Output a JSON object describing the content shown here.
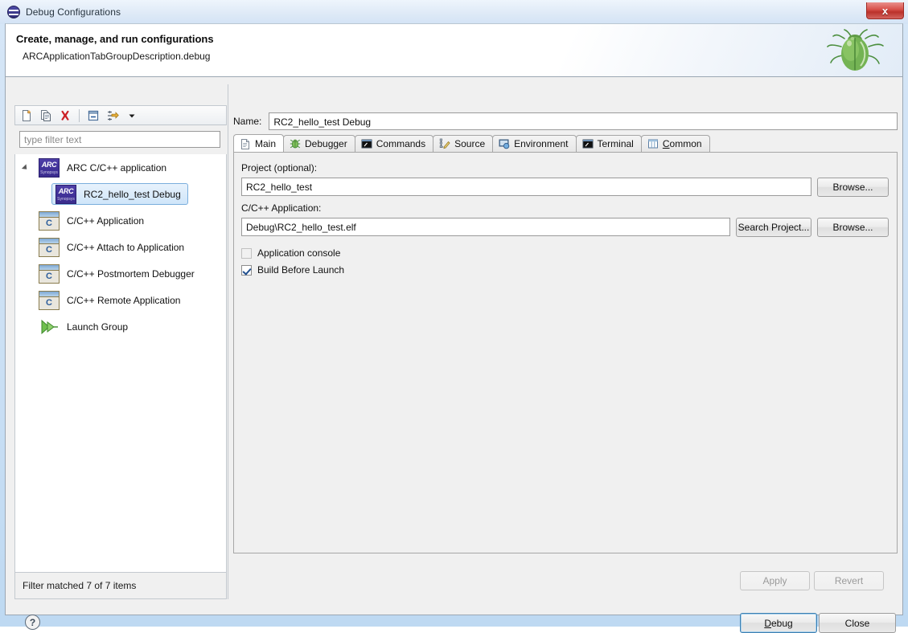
{
  "window": {
    "title": "Debug Configurations",
    "title_icon": "debug-icon",
    "close_label": "x"
  },
  "header": {
    "title": "Create, manage, and run configurations",
    "subtitle": "ARCApplicationTabGroupDescription.debug",
    "decoration_icon": "green-bug-icon"
  },
  "left_panel": {
    "toolbar": [
      {
        "name": "new-configuration-icon",
        "tooltip": "New launch configuration"
      },
      {
        "name": "duplicate-configuration-icon",
        "tooltip": "Duplicate"
      },
      {
        "name": "delete-configuration-icon",
        "tooltip": "Delete"
      },
      {
        "name": "collapse-all-icon",
        "tooltip": "Collapse All"
      },
      {
        "name": "filter-configurations-icon",
        "tooltip": "Filter"
      },
      {
        "name": "chevron-down-icon",
        "tooltip": "Menu"
      }
    ],
    "filter": {
      "placeholder": "type filter text",
      "value": ""
    },
    "tree": [
      {
        "label": "ARC C/C++ application",
        "icon": "arc-icon",
        "level": 0,
        "expanded": true,
        "selected": false
      },
      {
        "label": "RC2_hello_test Debug",
        "icon": "arc-icon",
        "level": 1,
        "expanded": false,
        "selected": true
      },
      {
        "label": "C/C++ Application",
        "icon": "c-application-icon",
        "level": 0,
        "expanded": false,
        "selected": false
      },
      {
        "label": "C/C++ Attach to Application",
        "icon": "c-application-icon",
        "level": 0,
        "expanded": false,
        "selected": false
      },
      {
        "label": "C/C++ Postmortem Debugger",
        "icon": "c-application-icon",
        "level": 0,
        "expanded": false,
        "selected": false
      },
      {
        "label": "C/C++ Remote Application",
        "icon": "c-application-icon",
        "level": 0,
        "expanded": false,
        "selected": false
      },
      {
        "label": "Launch Group",
        "icon": "launch-group-icon",
        "level": 0,
        "expanded": false,
        "selected": false
      }
    ],
    "status": "Filter matched 7 of 7 items",
    "arc_icon_text": {
      "top": "ARC",
      "bottom": "Synopsys"
    },
    "c_icon_glyph": "C"
  },
  "right_panel": {
    "name_label": "Name:",
    "name_value": "RC2_hello_test Debug",
    "tabs": [
      {
        "label": "Main",
        "icon": "document-icon",
        "active": true,
        "accel": ""
      },
      {
        "label": "Debugger",
        "icon": "bug-icon",
        "active": false,
        "accel": ""
      },
      {
        "label": "Commands",
        "icon": "console-icon",
        "active": false,
        "accel": ""
      },
      {
        "label": "Source",
        "icon": "source-edit-icon",
        "active": false,
        "accel": ""
      },
      {
        "label": "Environment",
        "icon": "environment-icon",
        "active": false,
        "accel": ""
      },
      {
        "label": "Terminal",
        "icon": "console-icon",
        "active": false,
        "accel": ""
      },
      {
        "label": "Common",
        "icon": "table-icon",
        "active": false,
        "accel": "C"
      }
    ],
    "main_tab": {
      "project_label": "Project (optional):",
      "project_value": "RC2_hello_test",
      "project_browse_label": "Browse...",
      "application_label": "C/C++ Application:",
      "application_value": "Debug\\RC2_hello_test.elf",
      "search_project_label": "Search Project...",
      "application_browse_label": "Browse...",
      "checkboxes": [
        {
          "label": "Application console",
          "checked": false,
          "enabled": false
        },
        {
          "label": "Build Before Launch",
          "checked": true,
          "enabled": true
        }
      ]
    },
    "apply_label": "Apply",
    "revert_label": "Revert",
    "apply_enabled": false,
    "revert_enabled": false
  },
  "footer": {
    "help_icon": "help-icon",
    "help_glyph": "?",
    "debug_label": "Debug",
    "debug_accel": "D",
    "close_label": "Close"
  },
  "colors": {
    "selection_border": "#7aaedd",
    "selection_bg": "#cfe5f9",
    "close_button": "#bb322b",
    "default_button_border": "#3c7fb1",
    "arc_icon": "#42339b"
  }
}
